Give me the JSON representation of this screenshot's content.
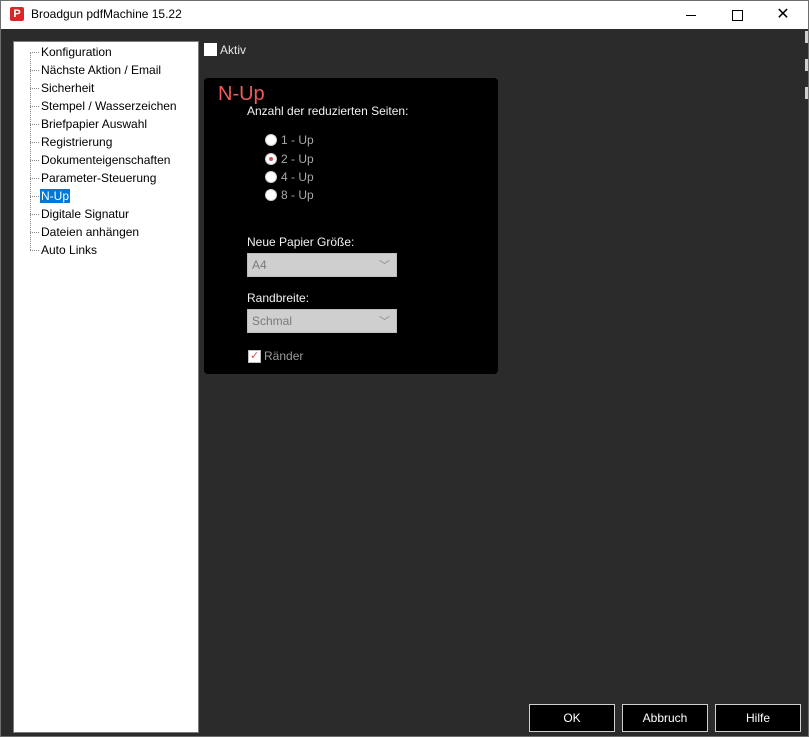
{
  "window": {
    "title": "Broadgun pdfMachine 15.22",
    "icon_letter": "P",
    "brand_color": "#d62828"
  },
  "tree": {
    "items": [
      {
        "label": "Konfiguration"
      },
      {
        "label": "Nächste Aktion / Email"
      },
      {
        "label": "Sicherheit"
      },
      {
        "label": "Stempel / Wasserzeichen"
      },
      {
        "label": "Briefpapier Auswahl"
      },
      {
        "label": "Registrierung"
      },
      {
        "label": "Dokumenteigenschaften"
      },
      {
        "label": "Parameter-Steuerung"
      },
      {
        "label": "N-Up",
        "selected": true
      },
      {
        "label": "Digitale Signatur"
      },
      {
        "label": "Dateien anhängen"
      },
      {
        "label": "Auto Links"
      }
    ],
    "selected_color": "#0078d7"
  },
  "aktiv": {
    "label": "Aktiv",
    "checked": false
  },
  "panel": {
    "title": "N-Up",
    "title_color": "#f05a5a",
    "count_label": "Anzahl der reduzierten Seiten:",
    "options": [
      {
        "label": "1 - Up",
        "checked": false
      },
      {
        "label": "2 - Up",
        "checked": true
      },
      {
        "label": "4 - Up",
        "checked": false
      },
      {
        "label": "8 - Up",
        "checked": false
      }
    ],
    "paper_label": "Neue Papier Größe:",
    "paper_value": "A4",
    "margin_label": "Randbreite:",
    "margin_value": "Schmal",
    "borders_label": "Ränder",
    "borders_checked": true
  },
  "buttons": {
    "ok": "OK",
    "cancel": "Abbruch",
    "help": "Hilfe"
  }
}
